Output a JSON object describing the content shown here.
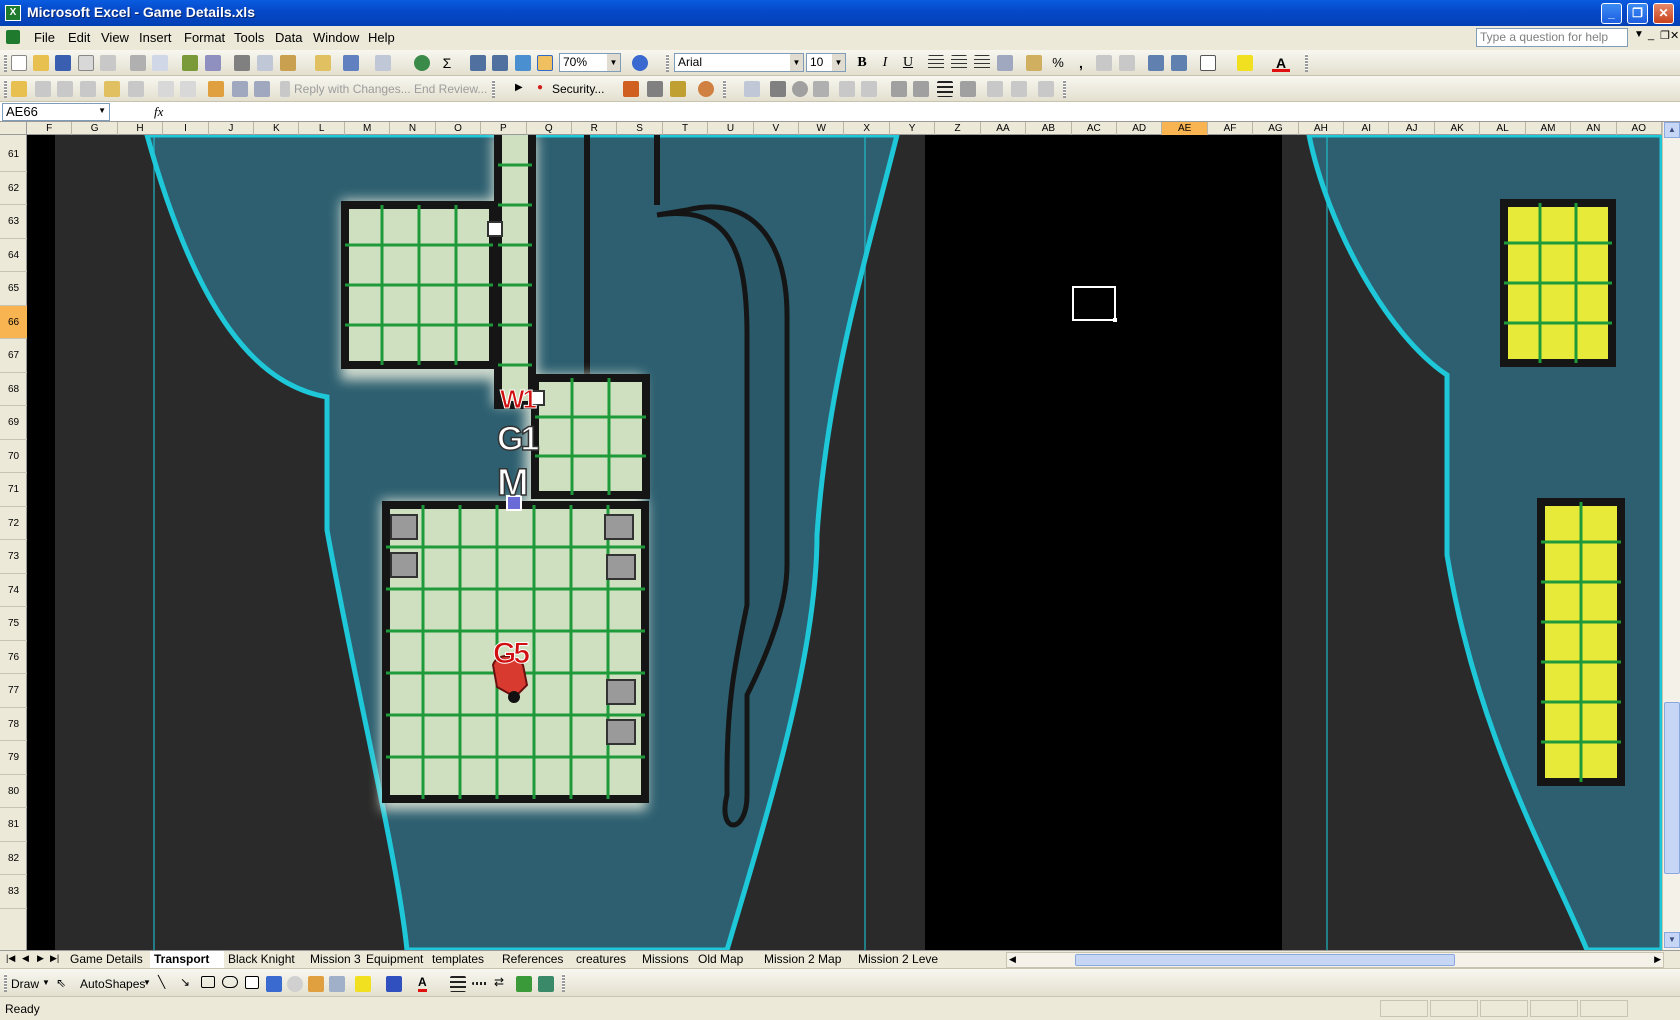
{
  "window": {
    "title": "Microsoft Excel - Game Details.xls",
    "controls": [
      "_",
      "❐",
      "✕"
    ]
  },
  "menubar": {
    "items": [
      "File",
      "Edit",
      "View",
      "Insert",
      "Format",
      "Tools",
      "Data",
      "Window",
      "Help"
    ],
    "help_placeholder": "Type a question for help"
  },
  "formatting": {
    "zoom": "70%",
    "font_name": "Arial",
    "font_size": "10",
    "bold": "B",
    "italic": "I",
    "underline": "U",
    "percent": "%",
    "comma": ","
  },
  "reviewing": {
    "reply_with_changes": "Reply with Changes...",
    "end_review": "End Review...",
    "security": "Security..."
  },
  "formula_bar": {
    "name_box": "AE66",
    "fx": "fx",
    "formula": ""
  },
  "columns": [
    "F",
    "G",
    "H",
    "I",
    "J",
    "K",
    "L",
    "M",
    "N",
    "O",
    "P",
    "Q",
    "R",
    "S",
    "T",
    "U",
    "V",
    "W",
    "X",
    "Y",
    "Z",
    "AA",
    "AB",
    "AC",
    "AD",
    "AE",
    "AF",
    "AG",
    "AH",
    "AI",
    "AJ",
    "AK",
    "AL",
    "AM",
    "AN",
    "AO"
  ],
  "active_column": "AE",
  "rows": [
    "61",
    "62",
    "63",
    "64",
    "65",
    "66",
    "67",
    "68",
    "69",
    "70",
    "71",
    "72",
    "73",
    "74",
    "75",
    "76",
    "77",
    "78",
    "79",
    "80",
    "81",
    "82",
    "83"
  ],
  "active_row": "66",
  "map": {
    "labels": {
      "w1": "W1",
      "g1": "G1",
      "m": "M",
      "g5": "G5"
    },
    "colors": {
      "background": "#2a2a2a",
      "water": "#2d5f70",
      "outline": "#1ec8d8",
      "floor": "#cfe0c0",
      "grid": "#1f9a3a",
      "yellow_room": "#e8ea3a",
      "label_red": "#d01010"
    }
  },
  "sheet_tabs": {
    "tabs": [
      "Game Details",
      "Transport",
      "Black Knight",
      "Mission 3",
      "Equipment",
      "templates",
      "References",
      "creatures",
      "Missions",
      "Old Map",
      "Mission 2 Map",
      "Mission 2 Leve"
    ],
    "active": "Transport"
  },
  "drawbar": {
    "draw": "Draw",
    "autoshapes": "AutoShapes"
  },
  "status": {
    "text": "Ready"
  }
}
